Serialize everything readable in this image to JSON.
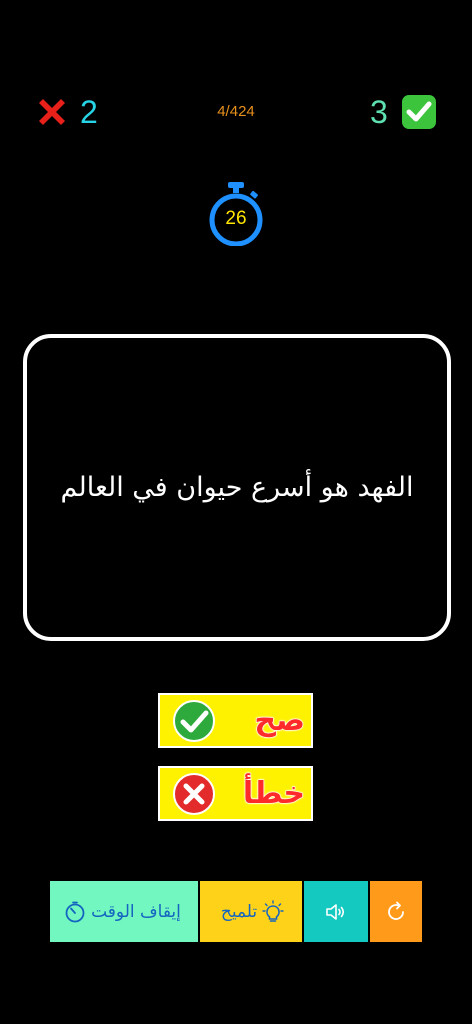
{
  "score": {
    "wrong_count": "2",
    "right_count": "3",
    "progress": "4/424",
    "colors": {
      "wrong_count": "#27d3e6",
      "right_count": "#5ee0b0",
      "progress": "#e8901c"
    },
    "wrong_icon": "red-x-icon",
    "right_icon": "green-checkmark-icon"
  },
  "timer": {
    "value": "26",
    "icon": "stopwatch-icon",
    "colors": {
      "ring": "#1e90ff",
      "value": "#ffe600"
    }
  },
  "question": {
    "text": "الفهد هو أسرع حيوان في العالم"
  },
  "answers": {
    "true_label": "صح",
    "false_label": "خطأ",
    "true_icon": "check-circle-icon",
    "false_icon": "x-circle-icon",
    "colors": {
      "button_bg": "#fff200",
      "label": "#ff2a2a"
    }
  },
  "toolbar": {
    "stop_timer_label": "إيقاف الوقت",
    "hint_label": "تلميح",
    "stop_timer_icon": "timer-icon",
    "hint_icon": "lightbulb-icon",
    "sound_icon": "speaker-icon",
    "reload_icon": "reload-icon",
    "colors": {
      "stop_timer_bg": "#72f7c0",
      "hint_bg": "#ffd21a",
      "sound_bg": "#13c9c0",
      "reload_bg": "#ff9a1a",
      "label": "#1565c0"
    }
  }
}
